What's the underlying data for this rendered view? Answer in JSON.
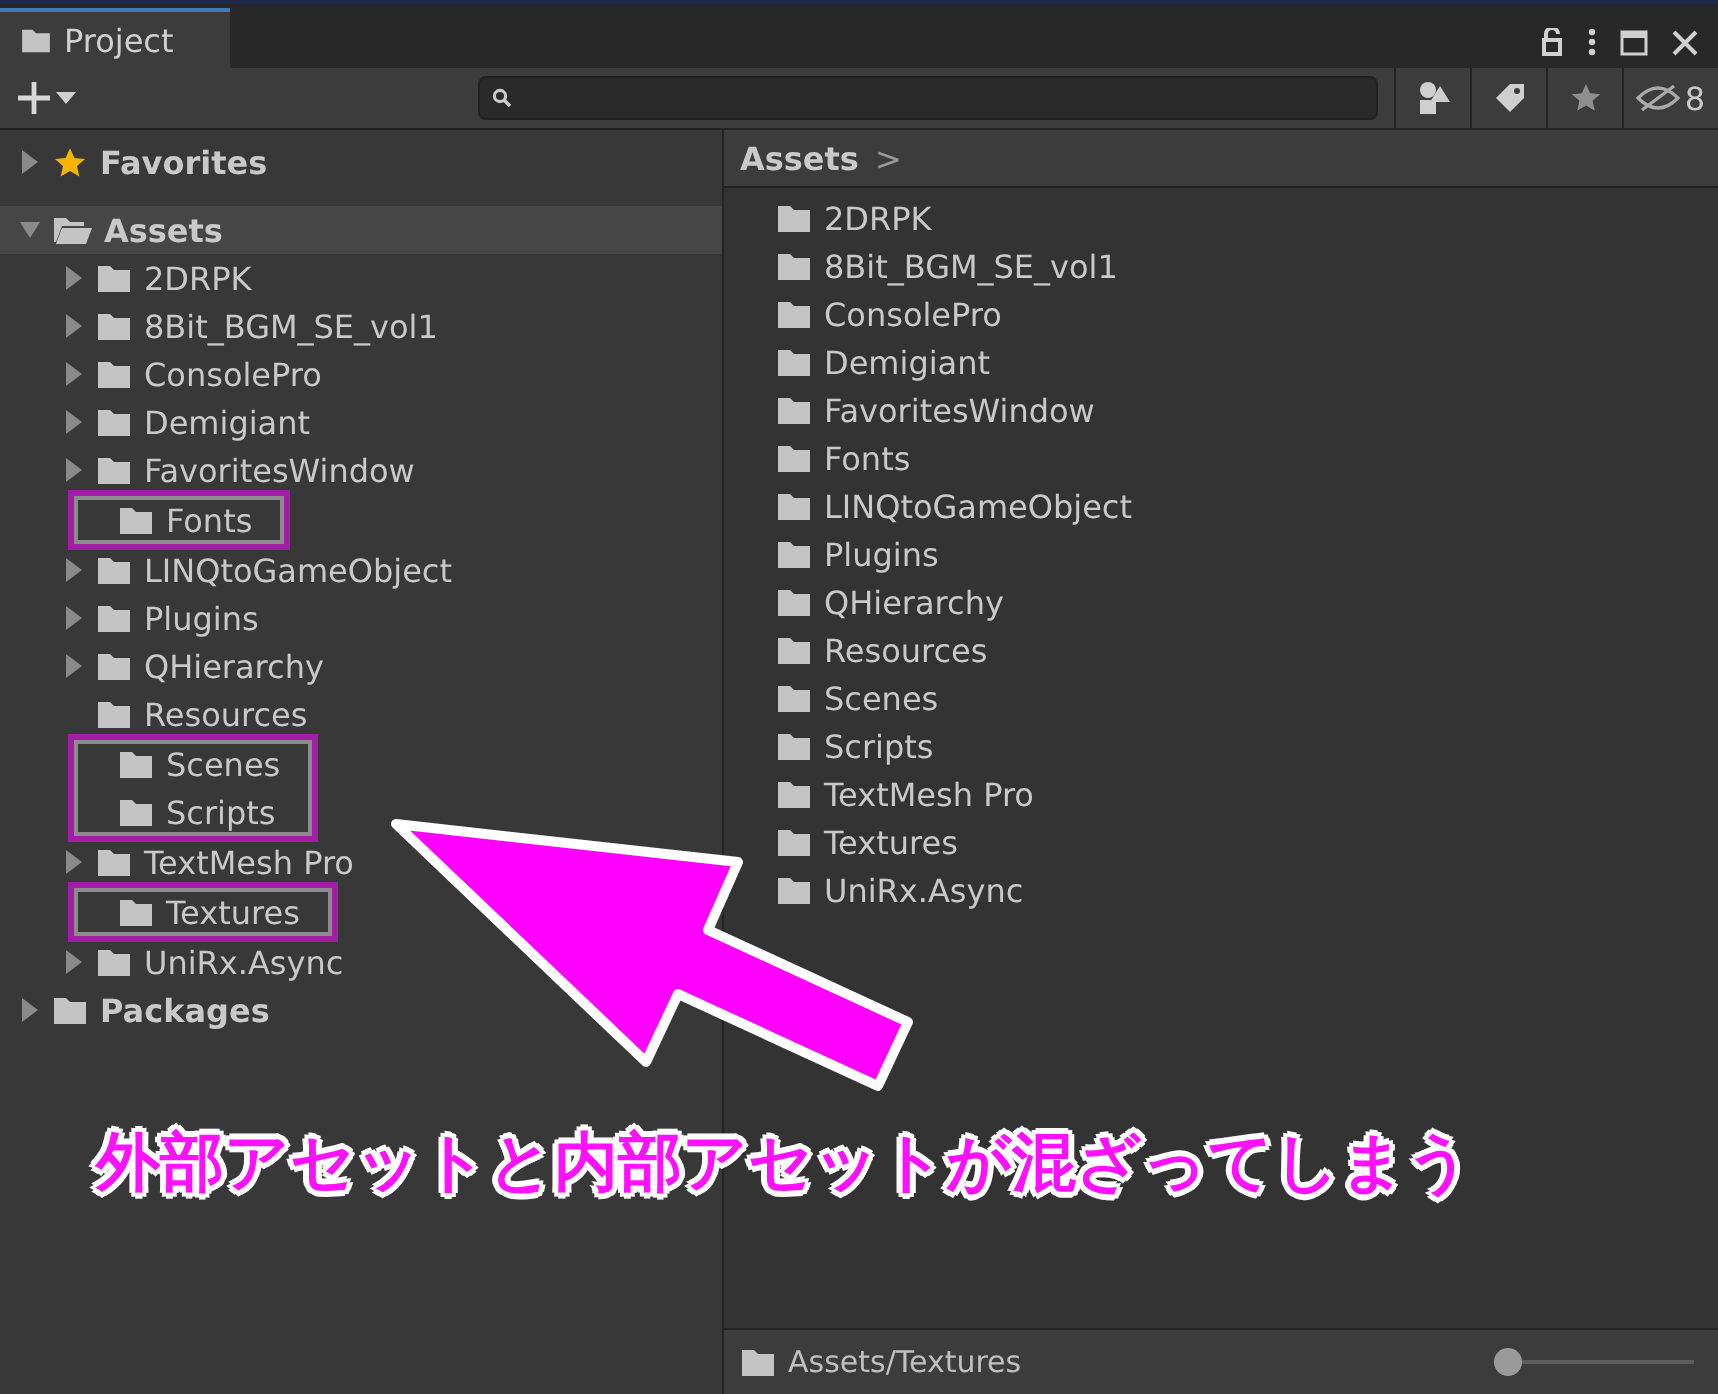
{
  "window": {
    "tab": "Project"
  },
  "toolbar": {
    "hidden_count": "8"
  },
  "tree": [
    {
      "label": "Favorites",
      "kind": "favorites",
      "expanded": false,
      "selected": false
    },
    {
      "label": "Assets",
      "kind": "folder",
      "expanded": true,
      "selected": true,
      "children": [
        {
          "label": "2DRPK",
          "expandable": true,
          "highlighted": false
        },
        {
          "label": "8Bit_BGM_SE_vol1",
          "expandable": true,
          "highlighted": false
        },
        {
          "label": "ConsolePro",
          "expandable": true,
          "highlighted": false
        },
        {
          "label": "Demigiant",
          "expandable": true,
          "highlighted": false
        },
        {
          "label": "FavoritesWindow",
          "expandable": true,
          "highlighted": false
        },
        {
          "label": "Fonts",
          "expandable": false,
          "highlighted": true
        },
        {
          "label": "LINQtoGameObject",
          "expandable": true,
          "highlighted": false
        },
        {
          "label": "Plugins",
          "expandable": true,
          "highlighted": false
        },
        {
          "label": "QHierarchy",
          "expandable": true,
          "highlighted": false
        },
        {
          "label": "Resources",
          "expandable": false,
          "highlighted": false
        },
        {
          "label": "Scenes",
          "expandable": false,
          "highlighted": true
        },
        {
          "label": "Scripts",
          "expandable": false,
          "highlighted": true
        },
        {
          "label": "TextMesh Pro",
          "expandable": true,
          "highlighted": false
        },
        {
          "label": "Textures",
          "expandable": false,
          "highlighted": true
        },
        {
          "label": "UniRx.Async",
          "expandable": true,
          "highlighted": false
        }
      ]
    },
    {
      "label": "Packages",
      "kind": "folder",
      "expanded": false,
      "selected": false
    }
  ],
  "breadcrumb": {
    "label": "Assets",
    "separator": ">"
  },
  "files": [
    "2DRPK",
    "8Bit_BGM_SE_vol1",
    "ConsolePro",
    "Demigiant",
    "FavoritesWindow",
    "Fonts",
    "LINQtoGameObject",
    "Plugins",
    "QHierarchy",
    "Resources",
    "Scenes",
    "Scripts",
    "TextMesh Pro",
    "Textures",
    "UniRx.Async"
  ],
  "status_bar": {
    "path": "Assets/Textures",
    "zoom": {
      "level": 0
    }
  },
  "annotation": {
    "caption": "外部アセットと内部アセットが混ざってしまう"
  }
}
